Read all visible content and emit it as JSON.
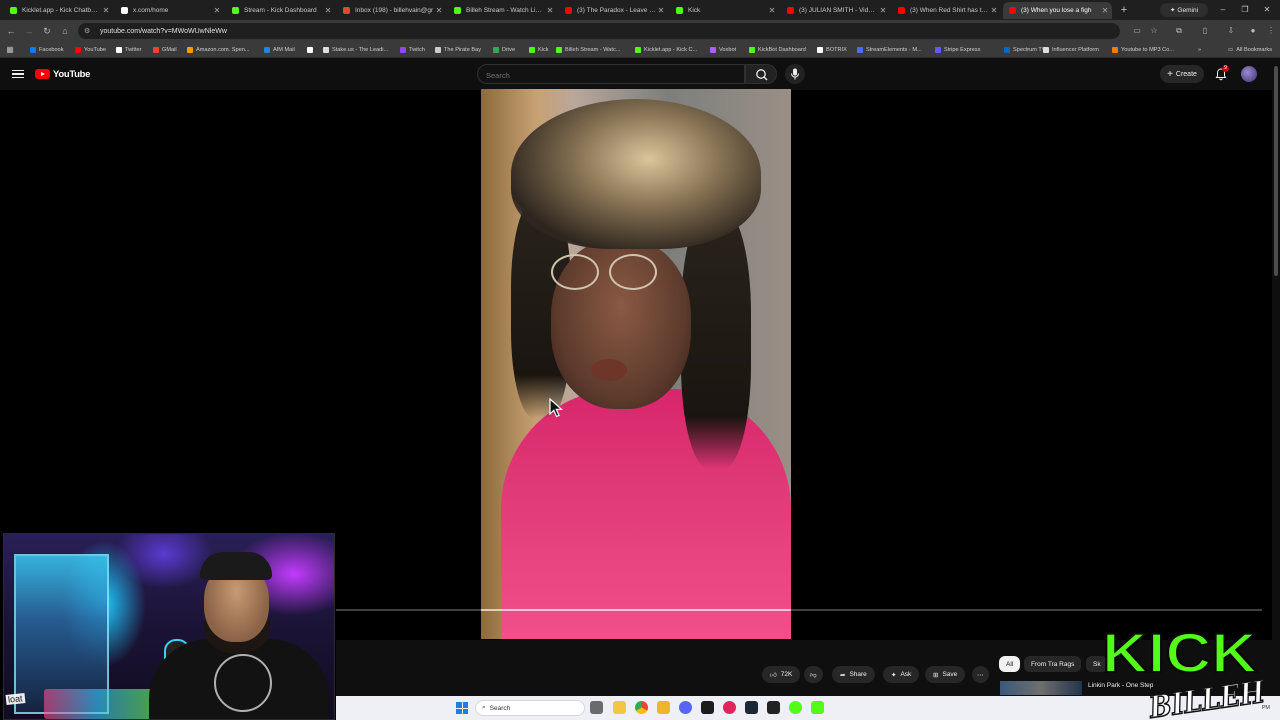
{
  "browser": {
    "tabs": [
      {
        "title": "Kicklet.app - Kick Chatbot a",
        "color": "#53fc18",
        "active": false
      },
      {
        "title": "x.com/home",
        "color": "#ffffff",
        "active": false
      },
      {
        "title": "Stream - Kick Dashboard",
        "color": "#53fc18",
        "active": false
      },
      {
        "title": "Inbox (198) - billehvain@gr",
        "color": "#ea4335",
        "active": false
      },
      {
        "title": "Billeh Stream - Watch Live c",
        "color": "#53fc18",
        "active": false
      },
      {
        "title": "(3) The Paradox - Leave My",
        "color": "#ff0000",
        "active": false
      },
      {
        "title": "Kick",
        "color": "#53fc18",
        "active": false
      },
      {
        "title": "(3) JULIAN SMITH - Video C",
        "color": "#ff0000",
        "active": false
      },
      {
        "title": "(3) When Red Shirt has to \"",
        "color": "#ff0000",
        "active": false
      },
      {
        "title": "(3) When you lose a figh",
        "color": "#ff0000",
        "active": true
      }
    ],
    "new_tab_symbol": "+",
    "gemini_label": "Gemini",
    "window_controls": {
      "minimize": "–",
      "restore": "❐",
      "close": "✕"
    },
    "url": "youtube.com/watch?v=MWoWUwNleWw",
    "bookmarks": [
      {
        "label": "Facebook",
        "color": "#1877f2"
      },
      {
        "label": "YouTube",
        "color": "#ff0000"
      },
      {
        "label": "Twitter",
        "color": "#ffffff"
      },
      {
        "label": "GMail",
        "color": "#ea4335"
      },
      {
        "label": "Amazon.com. Spen...",
        "color": "#ff9900"
      },
      {
        "label": "AIM Mail",
        "color": "#2a7de1"
      },
      {
        "label": "",
        "color": "#ffffff"
      },
      {
        "label": "Stake.us - The Leadi...",
        "color": "#dddddd"
      },
      {
        "label": "Twitch",
        "color": "#9146ff"
      },
      {
        "label": "The Pirate Bay",
        "color": "#cccccc"
      },
      {
        "label": "Drive",
        "color": "#34a853"
      },
      {
        "label": "Kick",
        "color": "#53fc18"
      },
      {
        "label": "Billeh Stream - Watc...",
        "color": "#53fc18"
      },
      {
        "label": "Kicklet.app - Kick C...",
        "color": "#53fc18"
      },
      {
        "label": "Voxbot",
        "color": "#b05cff"
      },
      {
        "label": "KickBot Dashboard",
        "color": "#53fc18"
      },
      {
        "label": "BOTRIX",
        "color": "#ffffff"
      },
      {
        "label": "StreamElements - M...",
        "color": "#4a6cf7"
      },
      {
        "label": "Stripe Express",
        "color": "#635bff"
      },
      {
        "label": "Spectrum TV",
        "color": "#0a66c2"
      },
      {
        "label": "Influencer Platform",
        "color": "#dddddd"
      },
      {
        "label": "Youtube to MP3 Co...",
        "color": "#ff7a00"
      }
    ],
    "bookmarks_more": "»",
    "all_bookmarks": "All Bookmarks"
  },
  "youtube": {
    "logo_text": "YouTube",
    "search_placeholder": "Search",
    "create_label": "Create",
    "notification_count": "9",
    "actions": {
      "likes": "72K",
      "share": "Share",
      "ask": "Ask",
      "save": "Save"
    },
    "chips": [
      "All",
      "From Tra Rags",
      "Sk"
    ],
    "next_video_title": "Linkin Park - One Step"
  },
  "overlay": {
    "kick_text": "KICK",
    "billeh_text": "BILLEH",
    "webcam_sticker": "loat"
  },
  "taskbar": {
    "search_label": "Search",
    "clock": "PM"
  }
}
